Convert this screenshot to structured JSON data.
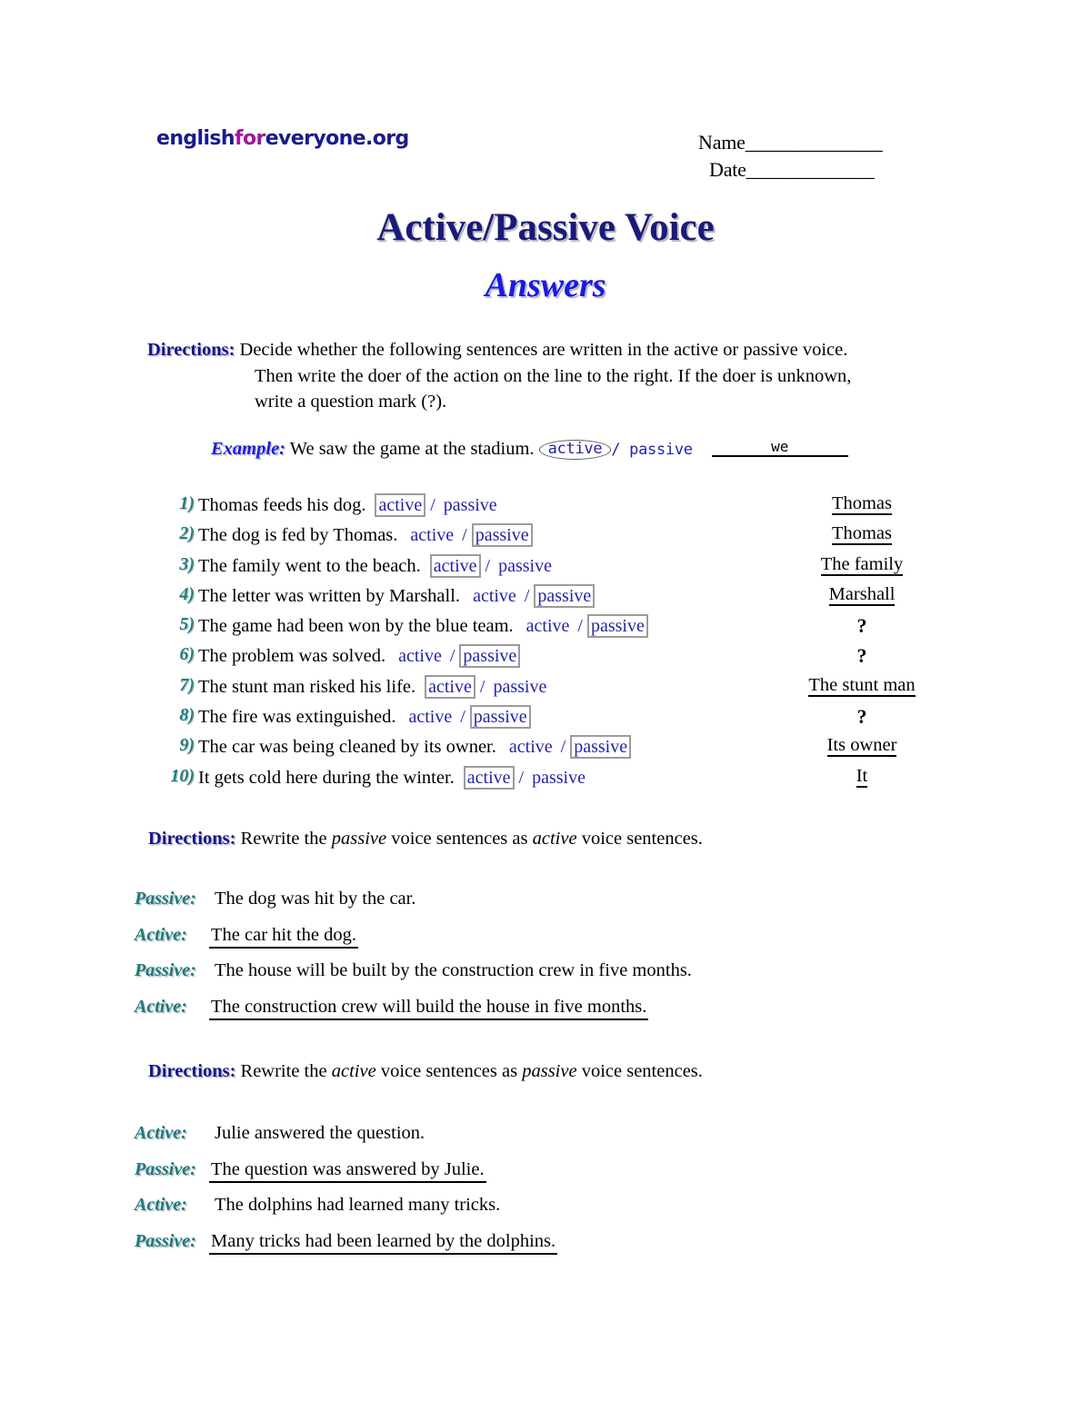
{
  "header": {
    "logo_part1": "english",
    "logo_part2": "for",
    "logo_part3": "everyone.org",
    "logo_colors": {
      "navy": "#1a1a8f",
      "magenta": "#a0189e"
    },
    "name_label": "Name",
    "name_rule": "_______________",
    "date_label": "Date",
    "date_rule": "______________"
  },
  "title": {
    "main": "Active/Passive Voice",
    "sub": "Answers",
    "main_color": "#1a1a7a",
    "sub_color": "#1a1ae0"
  },
  "directions": {
    "label": "Directions:",
    "color": "#14148c",
    "one_line1": "Decide whether the following sentences are written in the active or passive voice.",
    "one_line2": "Then write the doer of the action on the line to the right. If the doer is unknown,",
    "one_line3": "write a question mark (?).",
    "two_pre": "Rewrite the ",
    "two_ital1": "passive",
    "two_mid": " voice sentences as ",
    "two_ital2": "active",
    "two_post": " voice sentences.",
    "three_pre": "Rewrite the ",
    "three_ital1": "active",
    "three_mid": " voice sentences as ",
    "three_ital2": "passive",
    "three_post": " voice sentences."
  },
  "example": {
    "label": "Example:",
    "sentence": "We saw the game at the stadium.",
    "option_active": "active",
    "separator": "/",
    "option_passive": "passive",
    "answer": "we",
    "circled": "active"
  },
  "questions": [
    {
      "num": "1)",
      "sentence": "Thomas feeds his dog.",
      "active": "active",
      "passive": "passive",
      "selected": "active",
      "answer": "Thomas",
      "answer_underlined": true
    },
    {
      "num": "2)",
      "sentence": "The dog is fed by Thomas.",
      "active": "active",
      "passive": "passive",
      "selected": "passive",
      "answer": "Thomas",
      "answer_underlined": true
    },
    {
      "num": "3)",
      "sentence": "The family went to the beach.",
      "active": "active",
      "passive": "passive",
      "selected": "active",
      "answer": "The family",
      "answer_underlined": true
    },
    {
      "num": "4)",
      "sentence": "The letter was written by Marshall.",
      "active": "active",
      "passive": "passive",
      "selected": "passive",
      "answer": "Marshall",
      "answer_underlined": true
    },
    {
      "num": "5)",
      "sentence": "The game had been won by the blue team.",
      "active": "active",
      "passive": "passive",
      "selected": "passive",
      "answer": "?",
      "answer_underlined": false
    },
    {
      "num": "6)",
      "sentence": "The problem was solved.",
      "active": "active",
      "passive": "passive",
      "selected": "passive",
      "answer": "?",
      "answer_underlined": false
    },
    {
      "num": "7)",
      "sentence": "The stunt man risked his life.",
      "active": "active",
      "passive": "passive",
      "selected": "active",
      "answer": "The stunt man",
      "answer_underlined": true
    },
    {
      "num": "8)",
      "sentence": "The fire was extinguished.",
      "active": "active",
      "passive": "passive",
      "selected": "passive",
      "answer": "?",
      "answer_underlined": false
    },
    {
      "num": "9)",
      "sentence": "The car was being cleaned by its owner.",
      "active": "active",
      "passive": "passive",
      "selected": "passive",
      "answer": "Its owner",
      "answer_underlined": true
    },
    {
      "num": "10)",
      "sentence": "It gets cold here during the winter.",
      "active": "active",
      "passive": "passive",
      "selected": "active",
      "answer": "It",
      "answer_underlined": true
    }
  ],
  "rewrite_section_1": [
    {
      "label": "Passive:",
      "text": "The dog was hit by the car.",
      "is_answer": false
    },
    {
      "label": "Active:",
      "text": "The car hit the dog.",
      "is_answer": true
    },
    {
      "label": "Passive:",
      "text": "The house will be built by the construction crew in five months.",
      "is_answer": false
    },
    {
      "label": "Active:",
      "text": "The construction crew will build the house in five months.",
      "is_answer": true
    }
  ],
  "rewrite_section_2": [
    {
      "label": "Active:",
      "text": "Julie answered the question.",
      "is_answer": false
    },
    {
      "label": "Passive:",
      "text": "The question was answered by Julie.",
      "is_answer": true
    },
    {
      "label": "Active:",
      "text": "The dolphins had learned many tricks.",
      "is_answer": false
    },
    {
      "label": "Passive:",
      "text": "Many tricks had been learned by the dolphins.",
      "is_answer": true
    }
  ],
  "colors": {
    "teal": "#1f7f7f",
    "navy": "#14148c",
    "option_blue": "#2323a8",
    "box_gray": "#9b9b9b"
  }
}
